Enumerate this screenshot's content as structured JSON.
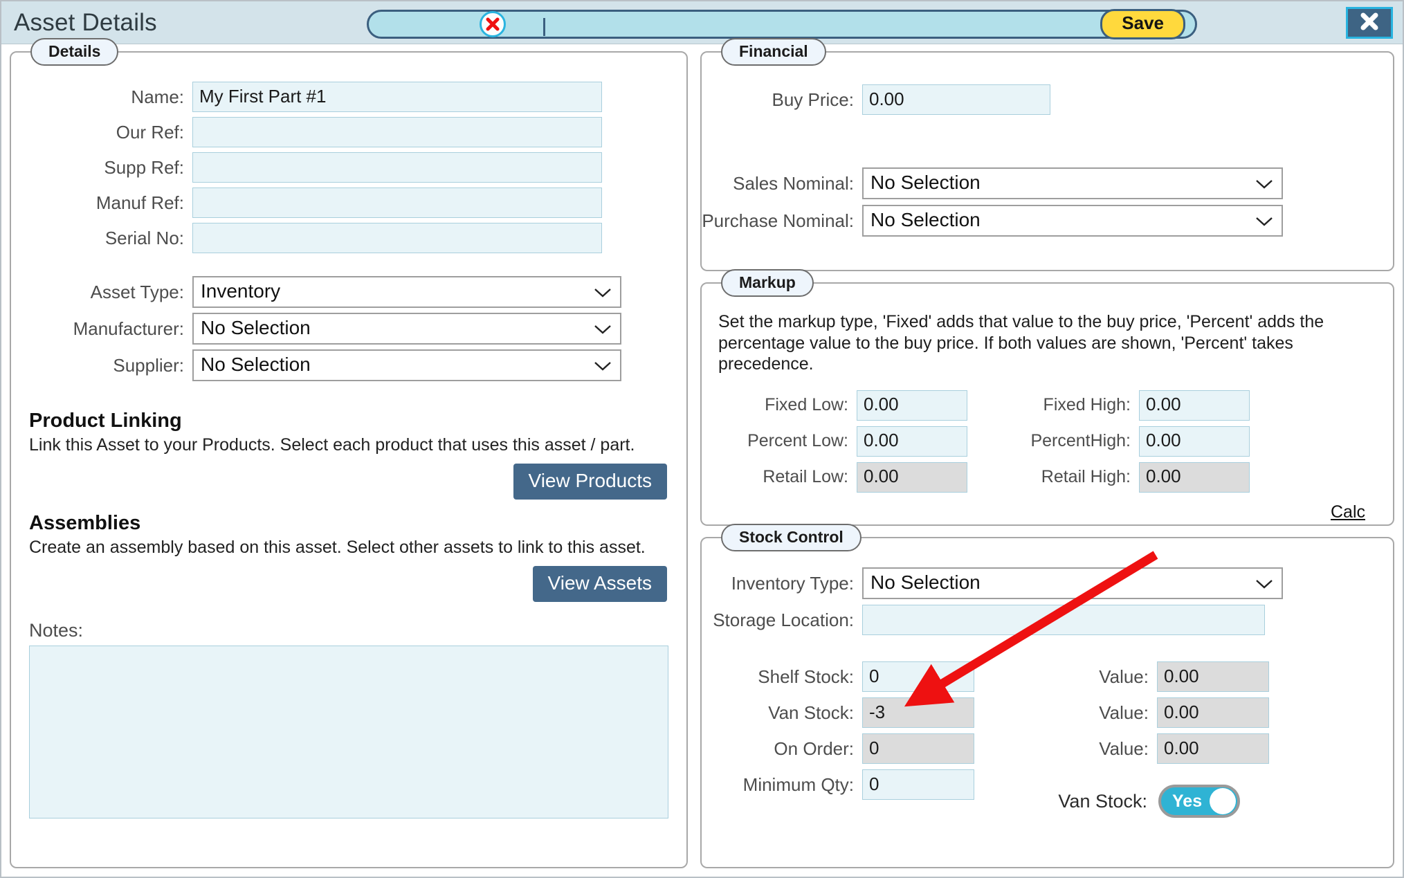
{
  "window": {
    "title": "Asset Details",
    "save_label": "Save",
    "close_icon": "close-x-icon",
    "delete_icon": "delete-circle-x-icon"
  },
  "details": {
    "legend": "Details",
    "fields": [
      {
        "label": "Name:",
        "value": "My First Part #1"
      },
      {
        "label": "Our Ref:",
        "value": ""
      },
      {
        "label": "Supp Ref:",
        "value": ""
      },
      {
        "label": "Manuf Ref:",
        "value": ""
      },
      {
        "label": "Serial No:",
        "value": ""
      }
    ],
    "selects": [
      {
        "label": "Asset Type:",
        "value": "Inventory"
      },
      {
        "label": "Manufacturer:",
        "value": "No Selection"
      },
      {
        "label": "Supplier:",
        "value": "No Selection"
      }
    ],
    "product_linking": {
      "heading": "Product Linking",
      "description": "Link this Asset to your Products. Select each product that uses this asset / part.",
      "button": "View Products"
    },
    "assemblies": {
      "heading": "Assemblies",
      "description": "Create an assembly based on this asset. Select other assets to link to this asset.",
      "button": "View Assets"
    },
    "notes": {
      "label": "Notes:",
      "value": ""
    }
  },
  "financial": {
    "legend": "Financial",
    "buy_price": {
      "label": "Buy Price:",
      "value": "0.00"
    },
    "selects": [
      {
        "label": "Sales Nominal:",
        "value": "No Selection"
      },
      {
        "label": "Purchase Nominal:",
        "value": "No Selection"
      }
    ]
  },
  "markup": {
    "legend": "Markup",
    "description": "Set the markup type, 'Fixed' adds that value to the buy price, 'Percent' adds the percentage value to the buy price. If both values are shown, 'Percent' takes precedence.",
    "left": [
      {
        "label": "Fixed Low:",
        "value": "0.00",
        "readonly": false
      },
      {
        "label": "Percent Low:",
        "value": "0.00",
        "readonly": false
      },
      {
        "label": "Retail Low:",
        "value": "0.00",
        "readonly": true
      }
    ],
    "right": [
      {
        "label": "Fixed High:",
        "value": "0.00",
        "readonly": false
      },
      {
        "label": "PercentHigh:",
        "value": "0.00",
        "readonly": false
      },
      {
        "label": "Retail High:",
        "value": "0.00",
        "readonly": true
      }
    ],
    "calc_link": "Calc"
  },
  "stock_control": {
    "legend": "Stock Control",
    "inventory_type": {
      "label": "Inventory Type:",
      "value": "No Selection"
    },
    "storage_location": {
      "label": "Storage Location:",
      "value": ""
    },
    "left": [
      {
        "label": "Shelf Stock:",
        "value": "0",
        "readonly": false
      },
      {
        "label": "Van Stock:",
        "value": "-3",
        "readonly": true
      },
      {
        "label": "On Order:",
        "value": "0",
        "readonly": true
      },
      {
        "label": "Minimum Qty:",
        "value": "0",
        "readonly": false
      }
    ],
    "right": [
      {
        "label": "Value:",
        "value": "0.00",
        "readonly": true
      },
      {
        "label": "Value:",
        "value": "0.00",
        "readonly": true
      },
      {
        "label": "Value:",
        "value": "0.00",
        "readonly": true
      }
    ],
    "van_stock_toggle": {
      "label": "Van Stock:",
      "state": "Yes"
    }
  },
  "annotation": {
    "type": "red-arrow",
    "points_to": "Shelf Stock field"
  },
  "colors": {
    "titlebar": "#d3e3ea",
    "pill": "#b2e0ea",
    "save": "#ffd93d",
    "dark_button": "#44688a",
    "field": "#e8f4f8",
    "readonly_field": "#dcdcdc",
    "toggle_on": "#2fb3d4",
    "arrow": "#ee1111"
  }
}
